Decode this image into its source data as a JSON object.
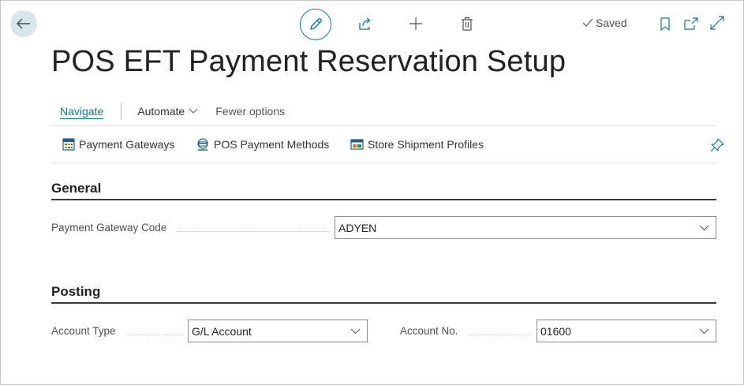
{
  "toolbar": {
    "saved_label": "Saved"
  },
  "page": {
    "title": "POS EFT Payment Reservation Setup"
  },
  "menu": {
    "navigate": "Navigate",
    "automate": "Automate",
    "fewer_options": "Fewer options"
  },
  "actions": [
    {
      "label": "Payment Gateways",
      "icon": "gateway-icon"
    },
    {
      "label": "POS Payment Methods",
      "icon": "payment-methods-icon"
    },
    {
      "label": "Store Shipment Profiles",
      "icon": "shipment-icon"
    }
  ],
  "general": {
    "title": "General",
    "payment_gateway_code_label": "Payment Gateway Code",
    "payment_gateway_code_value": "ADYEN"
  },
  "posting": {
    "title": "Posting",
    "account_type_label": "Account Type",
    "account_type_value": "G/L Account",
    "account_no_label": "Account No.",
    "account_no_value": "01600"
  },
  "colors": {
    "accent": "#0e7c86",
    "back_button_bg": "#d9e6ea"
  }
}
